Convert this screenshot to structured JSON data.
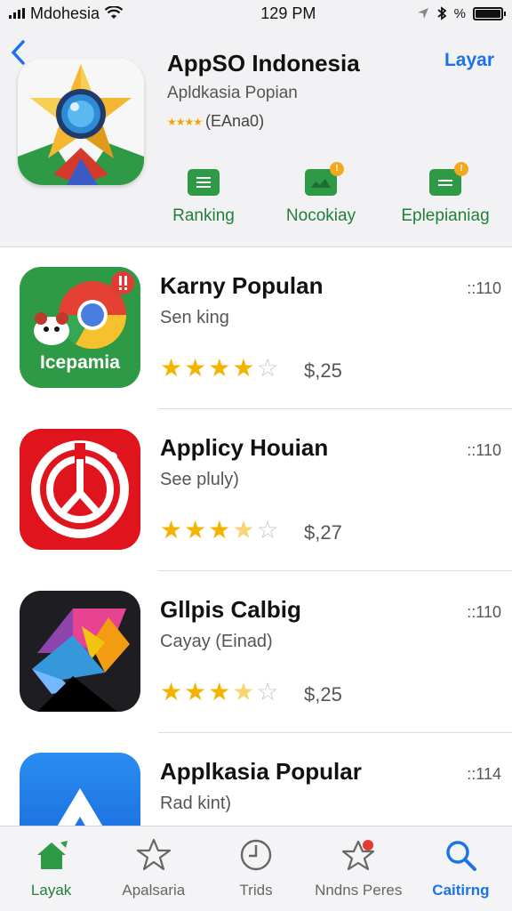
{
  "status_bar": {
    "carrier": "Mdohesia",
    "time": "129 PM",
    "battery_text": "%"
  },
  "header": {
    "back_icon": "chevron-left-icon",
    "app_title": "AppSO Indonesia",
    "app_subtitle": "Apldkasia Popian",
    "rating_text": "(EAna0)",
    "action_label": "Layar",
    "quick_actions": [
      {
        "label": "Ranking",
        "icon": "list-icon"
      },
      {
        "label": "Nocokiay",
        "icon": "folder-badge-icon"
      },
      {
        "label": "Eplepianiag",
        "icon": "list-badge-icon"
      }
    ]
  },
  "apps": [
    {
      "title": "Karny Populan",
      "subtitle": "Sen king",
      "rating": 4,
      "price": "$,25",
      "count": "::110",
      "icon_text": "Icepamia"
    },
    {
      "title": "Applicy Houian",
      "subtitle": "See pluly)",
      "rating": 3.5,
      "price": "$,27",
      "count": "::110"
    },
    {
      "title": "Gllpis Calbig",
      "subtitle": "Cayay  (Einad)",
      "rating": 3.5,
      "price": "$,25",
      "count": "::110"
    },
    {
      "title": "Applkasia Popular",
      "subtitle": "Rad kint)",
      "rating": 0,
      "price": "",
      "count": "::114"
    }
  ],
  "tab_bar": [
    {
      "label": "Layak",
      "icon": "home-icon",
      "color": "#217f3a"
    },
    {
      "label": "Apalsaria",
      "icon": "star-icon",
      "color": "#666666"
    },
    {
      "label": "Trids",
      "icon": "clock-icon",
      "color": "#666666"
    },
    {
      "label": "Nndns Peres",
      "icon": "star-badge-icon",
      "color": "#666666"
    },
    {
      "label": "Caitirng",
      "icon": "search-icon",
      "color": "#1a73e8"
    }
  ],
  "colors": {
    "accent_blue": "#1a73e8",
    "accent_green": "#217f3a",
    "star": "#f3b400"
  }
}
